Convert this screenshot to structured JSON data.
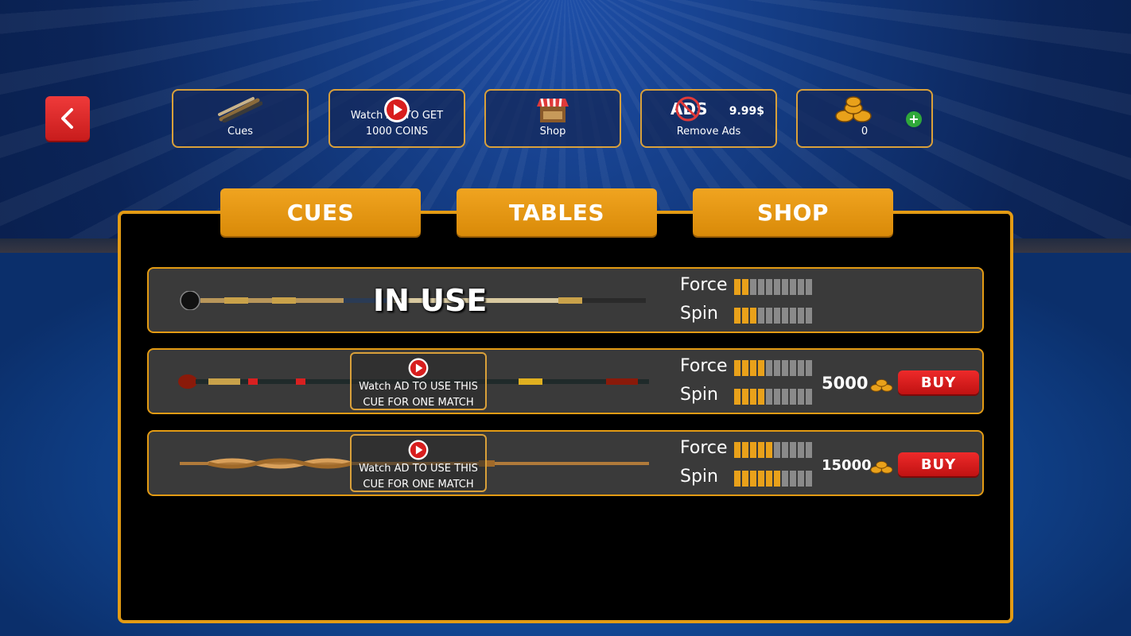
{
  "top_buttons": [
    {
      "label": "Cues",
      "icon": "cues-icon"
    },
    {
      "label": "Watch AD TO GET 1000 COINS",
      "icon": "play-icon"
    },
    {
      "label": "Shop",
      "icon": "shop-icon"
    },
    {
      "label": "Remove Ads",
      "price": "9.99$",
      "icon": "no-ads-icon"
    },
    {
      "label": "0",
      "icon": "coins-icon"
    }
  ],
  "tabs": [
    "CUES",
    "TABLES",
    "SHOP"
  ],
  "stat_labels": {
    "force": "Force",
    "spin": "Spin"
  },
  "cues": [
    {
      "status": "IN USE",
      "force": 2,
      "spin": 3,
      "max": 10
    },
    {
      "watch_label": "Watch AD TO USE THIS CUE FOR ONE MATCH",
      "price": "5000",
      "buy_label": "BUY",
      "force": 4,
      "spin": 4,
      "max": 10
    },
    {
      "watch_label": "Watch AD TO USE THIS CUE FOR ONE MATCH",
      "price": "15000",
      "buy_label": "BUY",
      "force": 5,
      "spin": 6,
      "max": 10
    }
  ],
  "colors": {
    "accent": "#e39b14",
    "buy": "#d41a1a",
    "bar_on": "#e9a11a",
    "bar_off": "#8a8a8a"
  }
}
